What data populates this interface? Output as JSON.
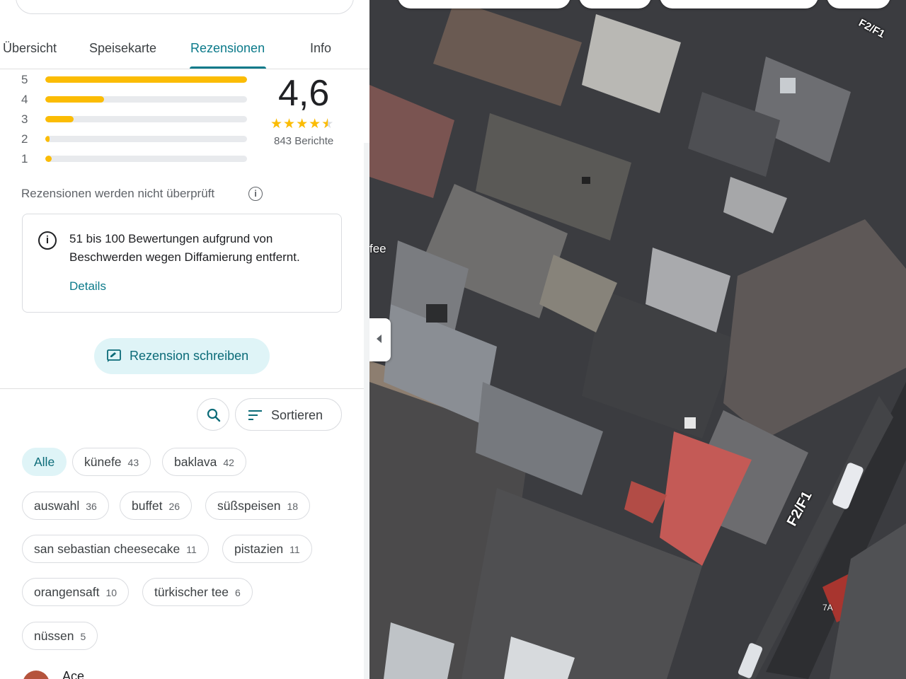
{
  "tabs": [
    {
      "label": "Übersicht"
    },
    {
      "label": "Speisekarte"
    },
    {
      "label": "Rezensionen"
    },
    {
      "label": "Info"
    }
  ],
  "active_tab": "Rezensionen",
  "rating": {
    "score": "4,6",
    "stars_value": 4.6,
    "count_label": "843 Berichte",
    "distribution": [
      {
        "stars": "5",
        "fraction": 1.0
      },
      {
        "stars": "4",
        "fraction": 0.29
      },
      {
        "stars": "3",
        "fraction": 0.14
      },
      {
        "stars": "2",
        "fraction": 0.02
      },
      {
        "stars": "1",
        "fraction": 0.03
      }
    ]
  },
  "unverified_note": "Rezensionen werden nicht überprüft",
  "notice": {
    "text": "51 bis 100 Bewertungen aufgrund von Beschwerden wegen Diffamierung entfernt.",
    "link": "Details"
  },
  "write_review_label": "Rezension schreiben",
  "sort_label": "Sortieren",
  "chips": [
    {
      "label": "Alle",
      "count": "",
      "selected": true
    },
    {
      "label": "künefe",
      "count": "43"
    },
    {
      "label": "baklava",
      "count": "42"
    },
    {
      "label": "auswahl",
      "count": "36"
    },
    {
      "label": "buffet",
      "count": "26"
    },
    {
      "label": "süßspeisen",
      "count": "18"
    },
    {
      "label": "san sebastian cheesecake",
      "count": "11"
    },
    {
      "label": "pistazien",
      "count": "11"
    },
    {
      "label": "orangensaft",
      "count": "10"
    },
    {
      "label": "türkischer tee",
      "count": "6"
    },
    {
      "label": "nüssen",
      "count": "5"
    }
  ],
  "first_reviewer": "Ace",
  "map": {
    "road_label": "F2/F1",
    "road_label_top": "F2/F1",
    "house_number": "7A",
    "place_fragment": "fee"
  },
  "colors": {
    "accent": "#0b7a8a",
    "star": "#fbbc04",
    "chip_selected_bg": "#dff4f7"
  }
}
